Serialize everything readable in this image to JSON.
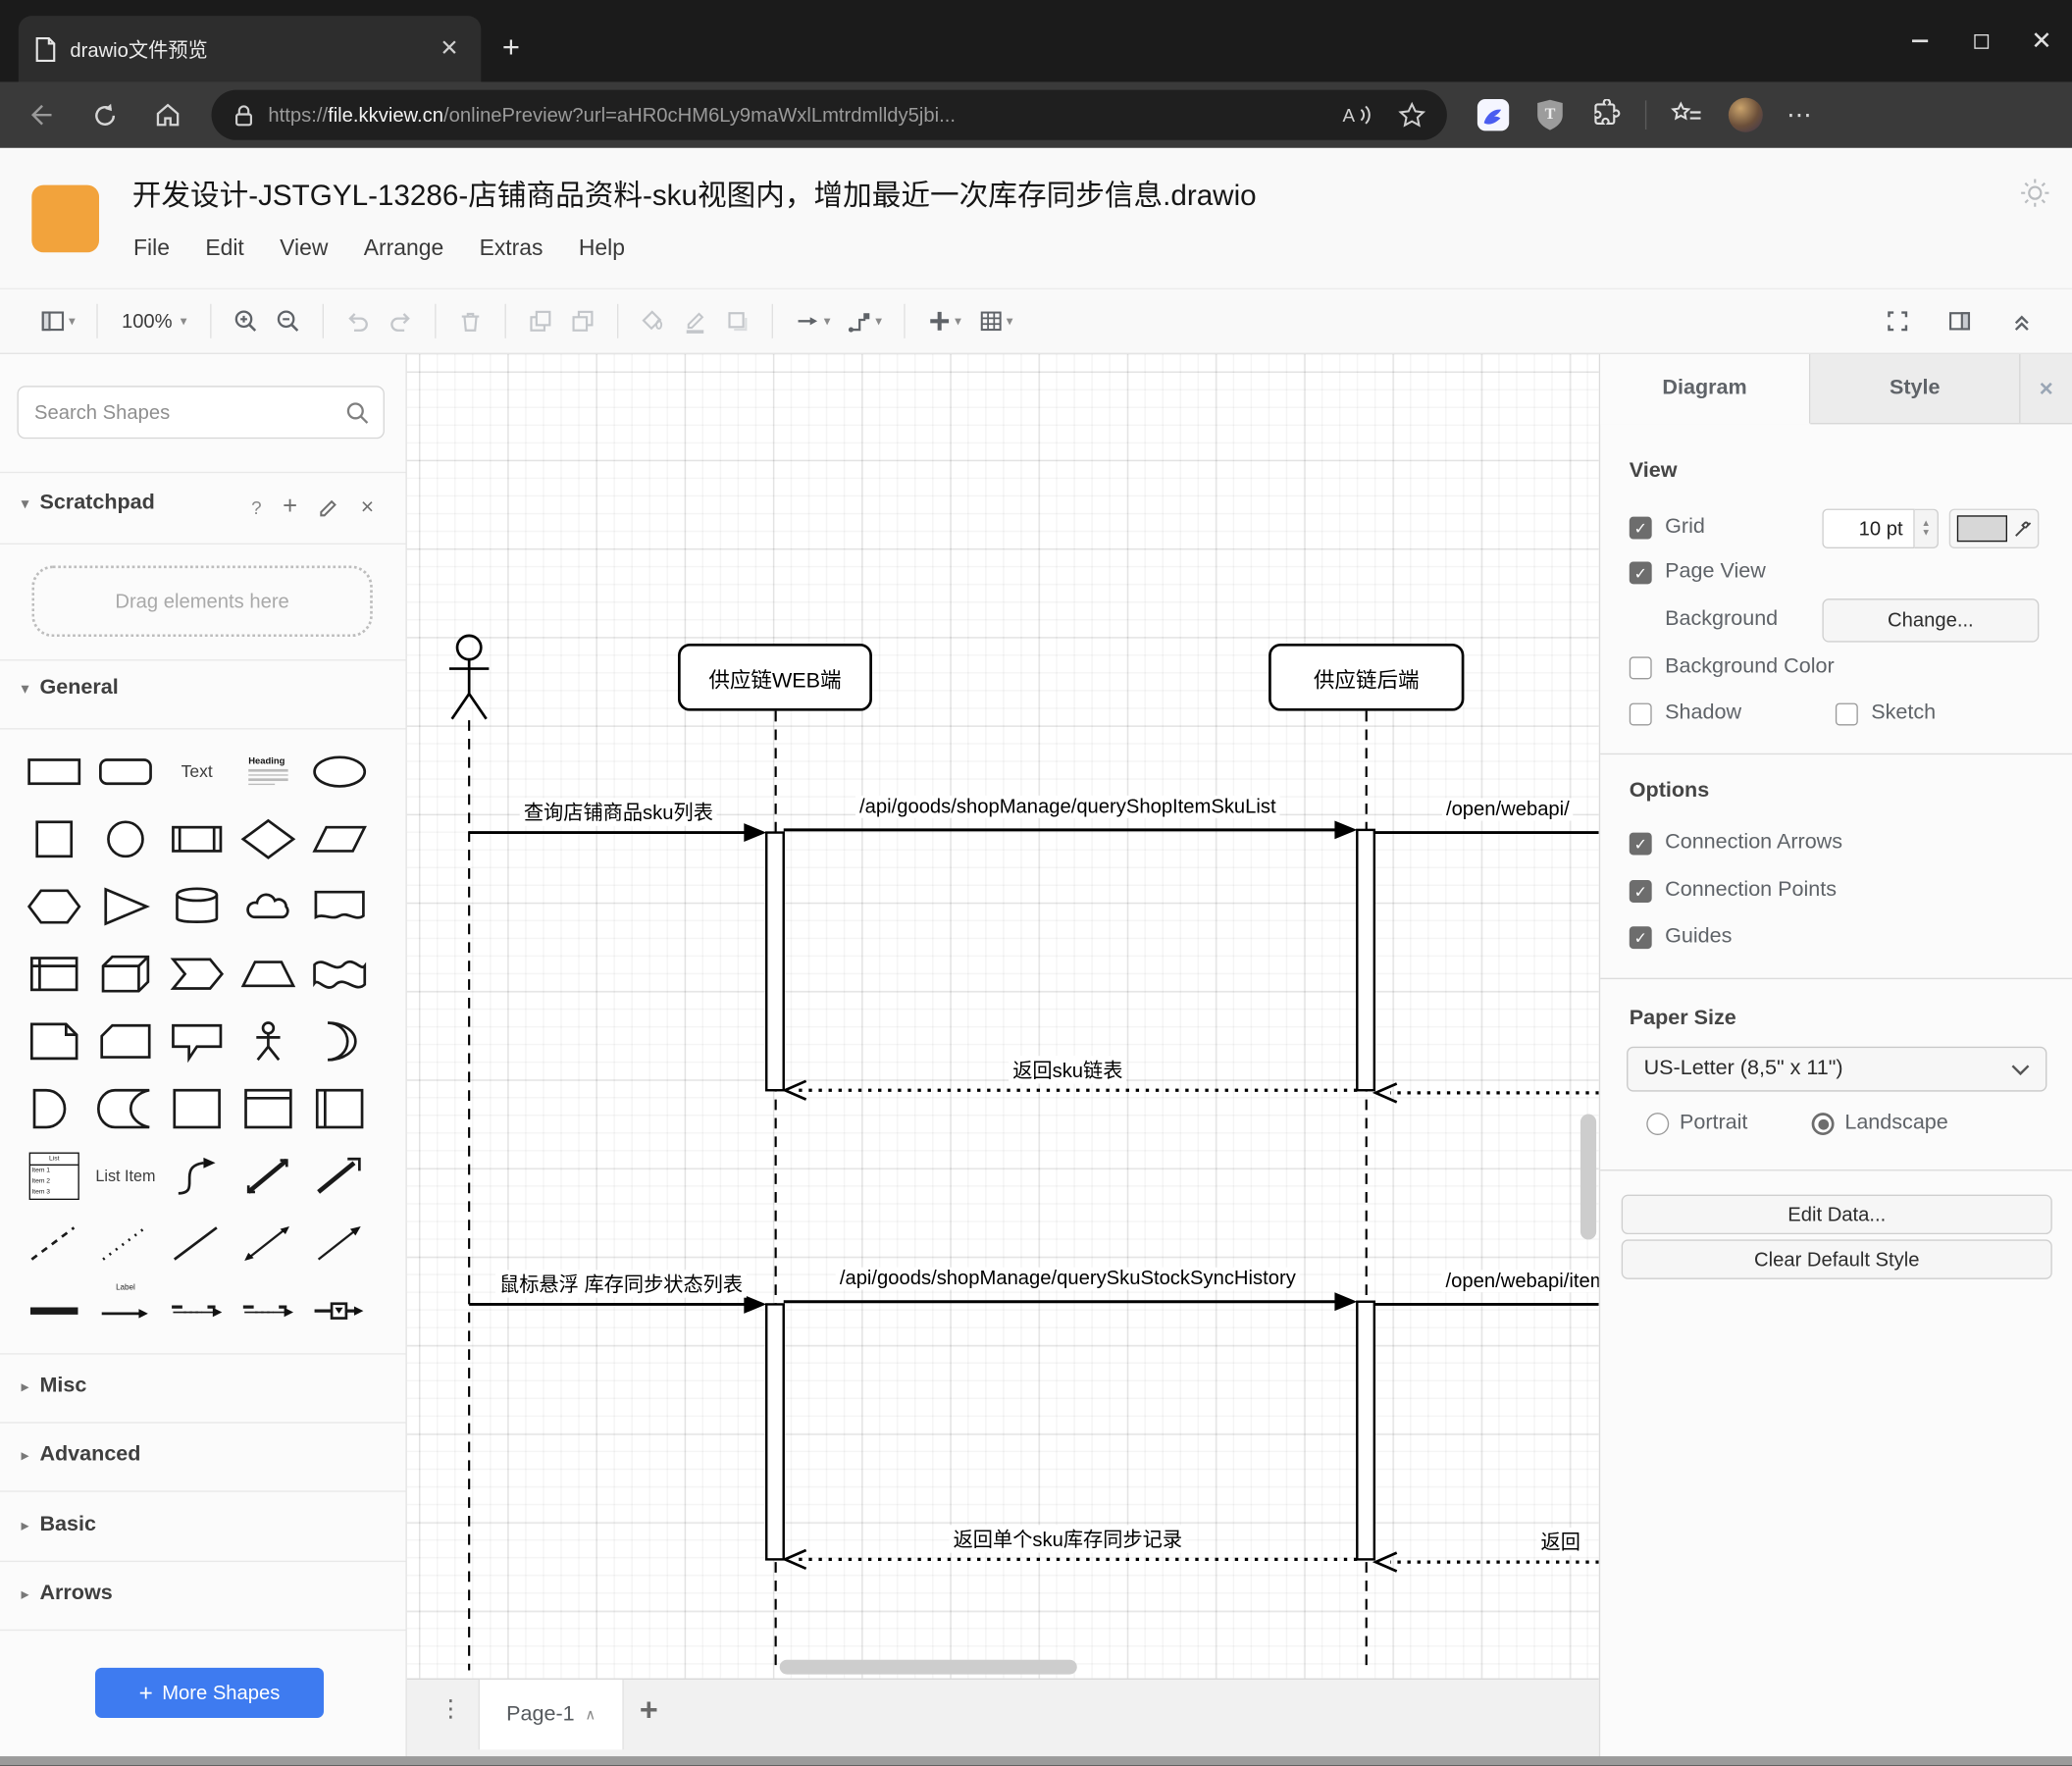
{
  "colors": {
    "accent_blue": "#3E7BF0",
    "logo_orange": "#F2A33C"
  },
  "browser": {
    "tab_title": "drawio文件预览",
    "url_scheme": "https://",
    "url_domain": "file.kkview.cn",
    "url_path": "/onlinePreview?url=aHR0cHM6Ly9maWxlLmtrdmlldy5jbi...",
    "icons": [
      "document-icon",
      "close-icon",
      "new-tab-icon",
      "minimize-icon",
      "maximize-icon",
      "close-window-icon",
      "back-icon",
      "refresh-icon",
      "home-icon",
      "lock-icon",
      "read-aloud-icon",
      "favorite-star-icon",
      "kkview-extension-icon",
      "tampermonkey-extension-icon",
      "extensions-puzzle-icon",
      "collections-icon",
      "profile-avatar",
      "more-menu-icon"
    ]
  },
  "app": {
    "title": "开发设计-JSTGYL-13286-店铺商品资料-sku视图内，增加最近一次库存同步信息.drawio",
    "menus": [
      "File",
      "Edit",
      "View",
      "Arrange",
      "Extras",
      "Help"
    ]
  },
  "toolbar": {
    "zoom_level": "100%",
    "items": [
      {
        "icon": "page-view",
        "caret": true
      },
      {
        "sep": true
      },
      {
        "zoom": true,
        "caret": true
      },
      {
        "sep": true
      },
      {
        "icon": "zoom-in"
      },
      {
        "icon": "zoom-out"
      },
      {
        "sep": true
      },
      {
        "icon": "undo",
        "disabled": true
      },
      {
        "icon": "redo",
        "disabled": true
      },
      {
        "sep": true
      },
      {
        "icon": "delete",
        "disabled": true
      },
      {
        "sep": true
      },
      {
        "icon": "to-front",
        "disabled": true
      },
      {
        "icon": "to-back",
        "disabled": true
      },
      {
        "sep": true
      },
      {
        "icon": "fill-color",
        "disabled": true
      },
      {
        "icon": "line-color",
        "disabled": true
      },
      {
        "icon": "shadow",
        "disabled": true
      },
      {
        "sep": true
      },
      {
        "icon": "connection",
        "caret": true
      },
      {
        "icon": "waypoints",
        "caret": true
      },
      {
        "sep": true
      },
      {
        "icon": "insert",
        "caret": true
      },
      {
        "icon": "table",
        "caret": true
      }
    ],
    "right_items": [
      {
        "icon": "fullscreen"
      },
      {
        "icon": "format-panel"
      },
      {
        "icon": "collapse"
      }
    ]
  },
  "sidebar": {
    "search_placeholder": "Search Shapes",
    "scratchpad_title": "Scratchpad",
    "drag_hint": "Drag elements here",
    "sections": [
      "General",
      "Misc",
      "Advanced",
      "Basic",
      "Arrows"
    ],
    "more_shapes": "More Shapes",
    "palette": {
      "text": "Text",
      "heading": "Heading",
      "list": "List",
      "item1": "Item 1",
      "item2": "Item 2",
      "item3": "Item 3",
      "list_item": "List Item",
      "label": "Label"
    },
    "shapes": [
      "rect",
      "rounded-rect",
      "text",
      "heading",
      "ellipse",
      "square",
      "circle",
      "process",
      "diamond",
      "parallelogram",
      "hexagon",
      "triangle",
      "cylinder",
      "cloud",
      "document",
      "internal-storage",
      "cube",
      "step",
      "trapezoid",
      "tape",
      "note",
      "card",
      "callout",
      "actor",
      "or",
      "and",
      "data-storage",
      "container",
      "container-title",
      "vertical-container",
      "list",
      "list-item",
      "curve",
      "bidirectional-arrow",
      "arrow-shape",
      "dashed-line",
      "dotted-line",
      "line",
      "bidirectional-thin-arrow",
      "thin-arrow",
      "link",
      "arrow-label",
      "dashed-arrow-label",
      "labeled-arrow",
      "arrow-box"
    ]
  },
  "canvas": {
    "participants": [
      "供应链WEB端",
      "供应链后端"
    ],
    "messages": [
      {
        "label": "查询店铺商品sku列表",
        "type": "call"
      },
      {
        "label": "/api/goods/shopManage/queryShopItemSkuList",
        "type": "call"
      },
      {
        "label": "/open/webapi/",
        "type": "call"
      },
      {
        "label": "返回sku链表",
        "type": "return"
      },
      {
        "label": "鼠标悬浮 库存同步状态列表",
        "type": "call"
      },
      {
        "label": "/api/goods/shopManage/querySkuStockSyncHistory",
        "type": "call"
      },
      {
        "label": "/open/webapi/item",
        "type": "call"
      },
      {
        "label": "返回单个sku库存同步记录",
        "type": "return"
      },
      {
        "label": "返回",
        "type": "return"
      }
    ]
  },
  "page_bar": {
    "page_label": "Page-1"
  },
  "format_panel": {
    "tab_diagram": "Diagram",
    "tab_style": "Style",
    "view_heading": "View",
    "grid_label": "Grid",
    "grid_size": "10 pt",
    "page_view_label": "Page View",
    "background_label": "Background",
    "change_button": "Change...",
    "background_color_label": "Background Color",
    "shadow_label": "Shadow",
    "sketch_label": "Sketch",
    "options_heading": "Options",
    "connection_arrows_label": "Connection Arrows",
    "connection_points_label": "Connection Points",
    "guides_label": "Guides",
    "paper_heading": "Paper Size",
    "paper_size_value": "US-Letter (8,5\" x 11\")",
    "portrait_label": "Portrait",
    "landscape_label": "Landscape",
    "edit_data_button": "Edit Data...",
    "clear_style_button": "Clear Default Style",
    "checks": {
      "grid": true,
      "page_view": true,
      "background_color": false,
      "shadow": false,
      "sketch": false,
      "connection_arrows": true,
      "connection_points": true,
      "guides": true
    },
    "orientation": "landscape"
  }
}
